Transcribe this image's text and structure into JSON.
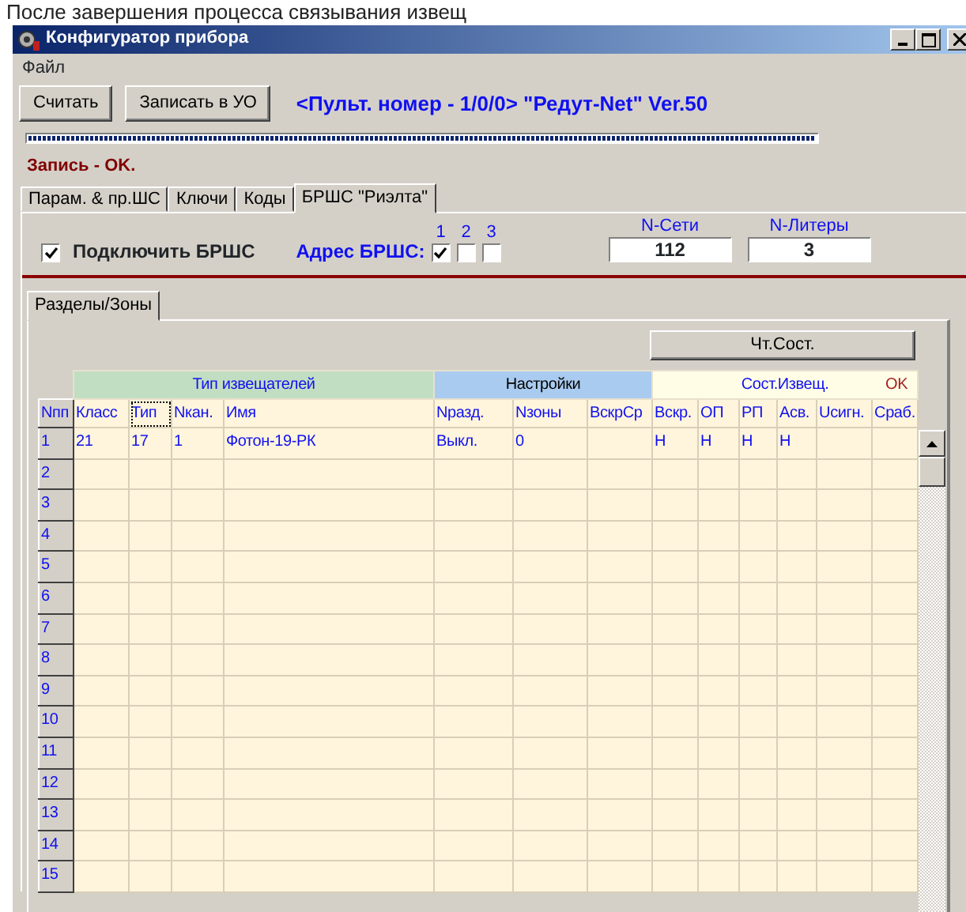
{
  "caption": "После завершения процесса связывания извещ",
  "window": {
    "title": "Конфигуратор прибора"
  },
  "menu": [
    "Файл"
  ],
  "buttons": [
    "Считать",
    "Записать в УО"
  ],
  "device_info": "<Пульт. номер - 1/0/0> \"Редут-Net\" Ver.50",
  "progress": {
    "level": 1
  },
  "status": "Запись - OK.",
  "tabs": [
    {
      "label": "Парам. & пр.ШС",
      "selected": false
    },
    {
      "label": "Ключи",
      "selected": false
    },
    {
      "label": "Коды",
      "selected": false
    },
    {
      "label": "БРШС \"Риэлта\"",
      "selected": true
    }
  ],
  "brsh": {
    "connect": {
      "label": "Подключить БРШС",
      "checked": true
    },
    "address_label": "Адрес БРШС:",
    "addresses": [
      {
        "label": "1",
        "checked": true
      },
      {
        "label": "2",
        "checked": false
      },
      {
        "label": "3",
        "checked": false
      }
    ],
    "network": {
      "label": "N-Сети",
      "value": "112"
    },
    "liter": {
      "label": "N-Литеры",
      "value": "3"
    }
  },
  "inner_tabs": [
    {
      "label": "Разделы/Зоны",
      "selected": true
    }
  ],
  "read_state_button": "Чт.Сост.",
  "table": {
    "index_column": "Nпп",
    "groups": [
      {
        "label": "Тип извещателей",
        "color": "#c2dec2",
        "columns": [
          {
            "label": "Класс",
            "focused": false
          },
          {
            "label": "Тип",
            "focused": true
          },
          {
            "label": "Nкан.",
            "focused": false
          },
          {
            "label": "Имя",
            "focused": false
          }
        ]
      },
      {
        "label": "Настройки",
        "color": "#a9cbf0",
        "columns": [
          {
            "label": "Nразд.",
            "focused": false
          },
          {
            "label": "Nзоны",
            "focused": false
          },
          {
            "label": "ВскрСр",
            "focused": false
          }
        ]
      },
      {
        "label": "Сост.Извещ.",
        "status": "OK",
        "color": "#fffde6",
        "columns": [
          {
            "label": "Вскр.",
            "focused": false
          },
          {
            "label": "ОП",
            "focused": false
          },
          {
            "label": "РП",
            "focused": false
          },
          {
            "label": "Асв.",
            "focused": false
          },
          {
            "label": "Uсигн.",
            "focused": false
          },
          {
            "label": "Сраб.",
            "focused": false
          }
        ]
      }
    ],
    "rows": [
      {
        "number": "1",
        "cells": [
          "21",
          "17",
          "1",
          "Фотон-19-РК",
          "Выкл.",
          "0",
          null,
          "Н",
          "Н",
          "Н",
          "Н",
          null,
          null
        ]
      },
      {
        "number": "2"
      },
      {
        "number": "3"
      },
      {
        "number": "4"
      },
      {
        "number": "5"
      },
      {
        "number": "6"
      },
      {
        "number": "7"
      },
      {
        "number": "8"
      },
      {
        "number": "9"
      },
      {
        "number": "10"
      },
      {
        "number": "11"
      },
      {
        "number": "12"
      },
      {
        "number": "13"
      },
      {
        "number": "14"
      },
      {
        "number": "15"
      }
    ]
  }
}
